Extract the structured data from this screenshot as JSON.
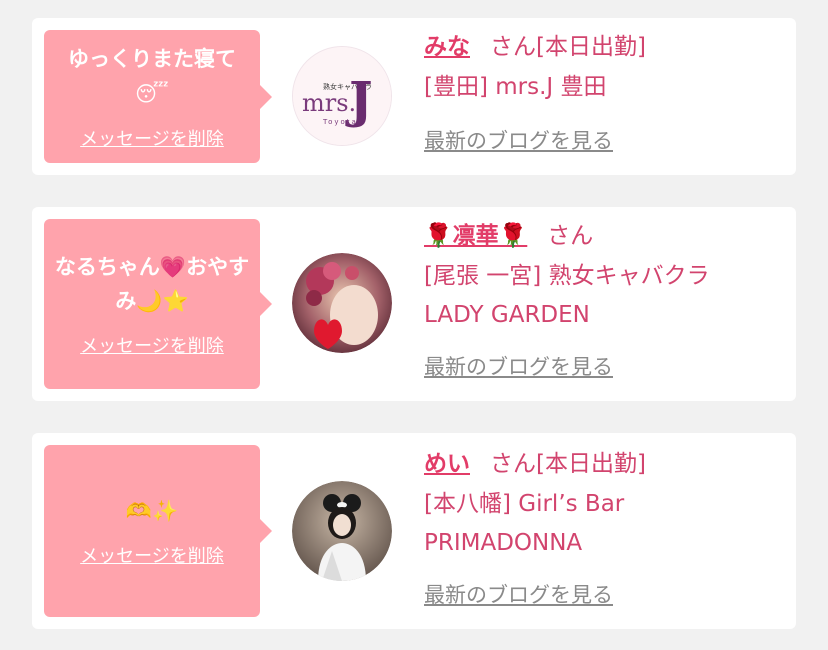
{
  "items": [
    {
      "message": "ゆっくりまた寝て",
      "message_emoji": "😴",
      "delete_label": "メッセージを削除",
      "avatar_logo_small": "熟女キャバクラ",
      "avatar_logo_main": "mrs.",
      "avatar_logo_letter": "J",
      "avatar_logo_sub": "Toyota",
      "name": "みな",
      "name_suffix": "さん[本日出勤]",
      "shop": "[豊田] mrs.J 豊田",
      "blog_label": "最新のブログを見る"
    },
    {
      "message": "なるちゃん💗おやすみ🌙⭐",
      "delete_label": "メッセージを削除",
      "name": "🌹凛華🌹",
      "name_suffix": "さん",
      "shop": "[尾張 一宮] 熟女キャバクラ LADY GARDEN",
      "blog_label": "最新のブログを見る"
    },
    {
      "message": "🫶✨",
      "delete_label": "メッセージを削除",
      "name": "めい",
      "name_suffix": "さん[本日出勤]",
      "shop": "[本八幡] Girl’s Bar PRIMADONNA",
      "blog_label": "最新のブログを見る"
    }
  ]
}
